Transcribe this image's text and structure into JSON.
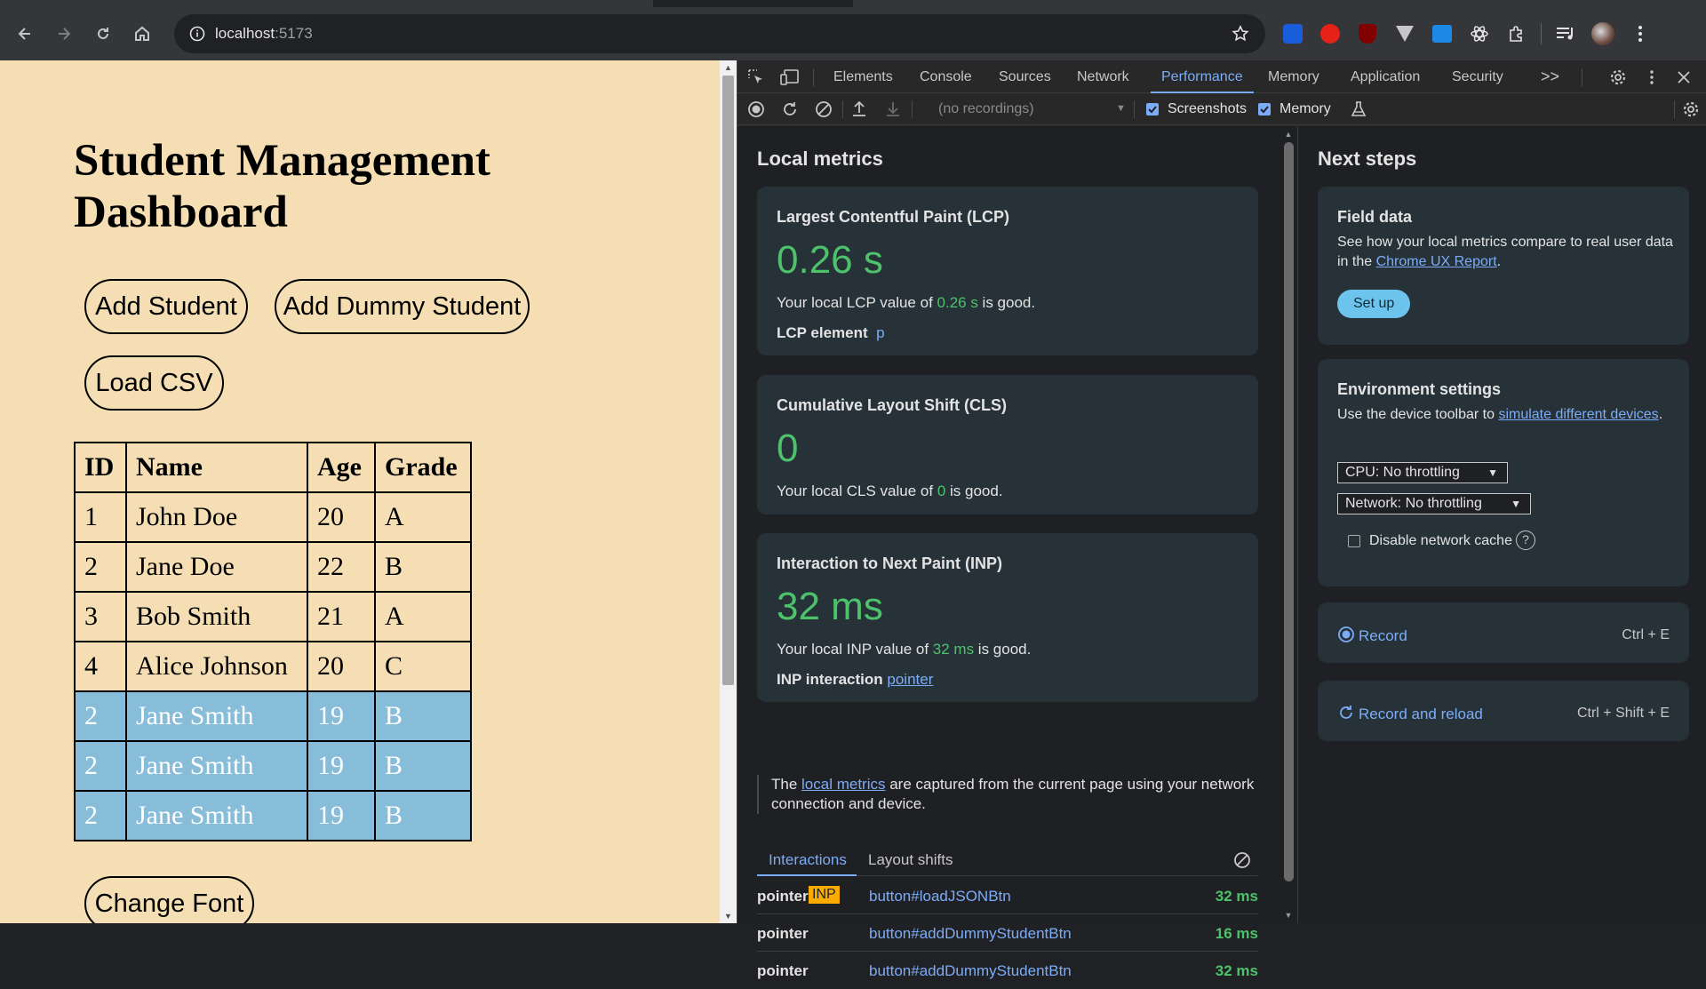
{
  "browser": {
    "url_host": "localhost",
    "url_port": ":5173"
  },
  "page": {
    "title": "Student Management Dashboard",
    "buttons": {
      "add_student": "Add Student",
      "add_dummy": "Add Dummy Student",
      "load_csv": "Load CSV",
      "change_font": "Change Font"
    },
    "table": {
      "headers": [
        "ID",
        "Name",
        "Age",
        "Grade"
      ],
      "rows": [
        {
          "id": "1",
          "name": "John Doe",
          "age": "20",
          "grade": "A"
        },
        {
          "id": "2",
          "name": "Jane Doe",
          "age": "22",
          "grade": "B"
        },
        {
          "id": "3",
          "name": "Bob Smith",
          "age": "21",
          "grade": "A"
        },
        {
          "id": "4",
          "name": "Alice Johnson",
          "age": "20",
          "grade": "C"
        },
        {
          "id": "2",
          "name": "Jane Smith",
          "age": "19",
          "grade": "B"
        },
        {
          "id": "2",
          "name": "Jane Smith",
          "age": "19",
          "grade": "B"
        },
        {
          "id": "2",
          "name": "Jane Smith",
          "age": "19",
          "grade": "B"
        }
      ]
    }
  },
  "devtools": {
    "tabs": [
      "Elements",
      "Console",
      "Sources",
      "Network",
      "Performance",
      "Memory",
      "Application",
      "Security"
    ],
    "active_tab": "Performance",
    "more": ">>",
    "toolbar": {
      "recordings": "(no recordings)",
      "screenshots": "Screenshots",
      "memory": "Memory"
    },
    "local_metrics": {
      "title": "Local metrics",
      "lcp": {
        "title": "Largest Contentful Paint (LCP)",
        "value": "0.26 s",
        "desc_pre": "Your local LCP value of ",
        "desc_val": "0.26 s",
        "desc_post": " is good.",
        "element_label": "LCP element",
        "element_value": "p"
      },
      "cls": {
        "title": "Cumulative Layout Shift (CLS)",
        "value": "0",
        "desc_pre": "Your local CLS value of ",
        "desc_val": "0",
        "desc_post": " is good."
      },
      "inp": {
        "title": "Interaction to Next Paint (INP)",
        "value": "32 ms",
        "desc_pre": "Your local INP value of ",
        "desc_val": "32 ms",
        "desc_post": " is good.",
        "interaction_label": "INP interaction",
        "interaction_value": "pointer"
      },
      "note": {
        "pre": "The ",
        "link": "local metrics",
        "post": " are captured from the current page using your network connection and device."
      }
    },
    "interactions": {
      "tabs": [
        "Interactions",
        "Layout shifts"
      ],
      "rows": [
        {
          "type": "pointer",
          "badge": "INP",
          "target": "button#loadJSONBtn",
          "duration": "32 ms"
        },
        {
          "type": "pointer",
          "badge": "",
          "target": "button#addDummyStudentBtn",
          "duration": "16 ms"
        },
        {
          "type": "pointer",
          "badge": "",
          "target": "button#addDummyStudentBtn",
          "duration": "32 ms"
        }
      ]
    },
    "next_steps": {
      "title": "Next steps",
      "field_data": {
        "title": "Field data",
        "text_pre": "See how your local metrics compare to real user data in the ",
        "link": "Chrome UX Report",
        "text_post": ".",
        "button": "Set up"
      },
      "environment": {
        "title": "Environment settings",
        "text_pre": "Use the device toolbar to ",
        "link": "simulate different devices",
        "text_post": ".",
        "cpu": "CPU: No throttling",
        "network": "Network: No throttling",
        "cache": "Disable network cache"
      },
      "record": {
        "label": "Record",
        "shortcut": "Ctrl + E"
      },
      "record_reload": {
        "label": "Record and reload",
        "shortcut": "Ctrl + Shift + E"
      }
    }
  }
}
